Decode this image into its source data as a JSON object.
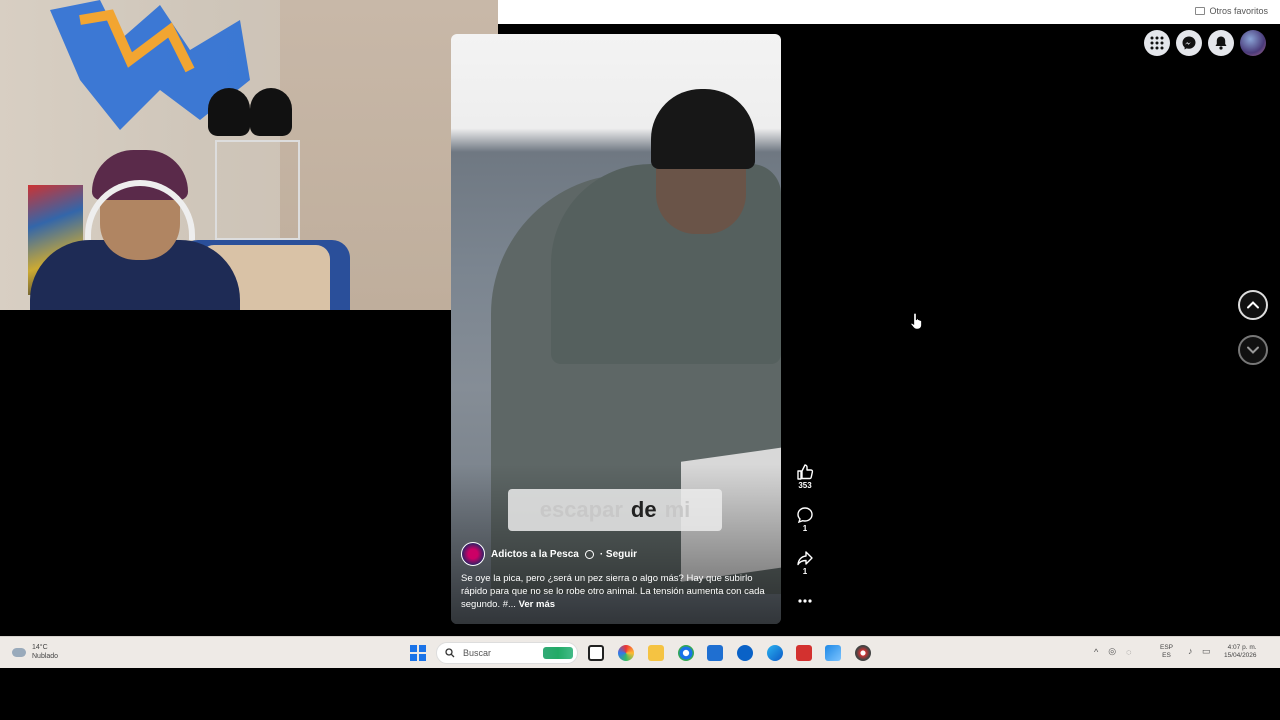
{
  "browser": {
    "favorites_label": "Otros favoritos"
  },
  "reel": {
    "caption_words": [
      "escapar",
      "de",
      "mi"
    ],
    "author_name": "Adictos a la Pesca",
    "follow_label": "· Seguir",
    "description": "Se oye la pica, pero ¿será un pez sierra o algo más? Hay que subirlo rápido para que no se lo robe otro animal. La tensión aumenta con cada segundo. #...",
    "see_more_label": "Ver más",
    "likes_count": "353",
    "comments_count": "1",
    "shares_count": "1"
  },
  "top_icons": [
    "apps-grid-icon",
    "messenger-icon",
    "notifications-bell-icon",
    "profile-avatar"
  ],
  "taskbar": {
    "weather_temp": "14°C",
    "weather_desc": "Nublado",
    "search_placeholder": "Buscar",
    "lang_line1": "ESP",
    "lang_line2": "ES",
    "time": "4:07 p. m.",
    "date": "15/04/2026"
  },
  "colors": {
    "accent_blue": "#1a73e8",
    "background": "#000000",
    "taskbar": "#eeeae6"
  }
}
